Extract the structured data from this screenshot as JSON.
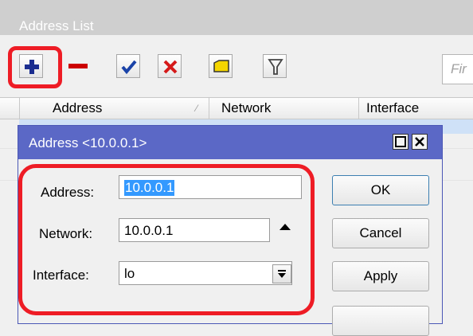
{
  "window": {
    "title": "Address List"
  },
  "toolbar": {
    "buttons": [
      {
        "name": "add",
        "icon": "plus-icon",
        "color": "#1b2d8f"
      },
      {
        "name": "remove",
        "icon": "minus-icon",
        "color": "#cc0000"
      },
      {
        "name": "enable",
        "icon": "check-icon",
        "color": "#1a43a8"
      },
      {
        "name": "disable",
        "icon": "x-icon",
        "color": "#d51a1a"
      },
      {
        "name": "comment",
        "icon": "note-icon",
        "color": "#f5d600"
      },
      {
        "name": "filter",
        "icon": "filter-icon",
        "color": "#444444"
      }
    ],
    "find_placeholder": "Fir"
  },
  "table": {
    "columns": [
      "Address",
      "Network",
      "Interface"
    ]
  },
  "dialog": {
    "title": "Address <10.0.0.1>",
    "fields": {
      "address": {
        "label": "Address:",
        "value": "10.0.0.1"
      },
      "network": {
        "label": "Network:",
        "value": "10.0.0.1"
      },
      "interface": {
        "label": "Interface:",
        "value": "lo"
      }
    },
    "buttons": {
      "ok": "OK",
      "cancel": "Cancel",
      "apply": "Apply"
    }
  },
  "colors": {
    "highlight": "#ee1c25",
    "dialog_title": "#5b68c6",
    "selection": "#3399ff"
  }
}
